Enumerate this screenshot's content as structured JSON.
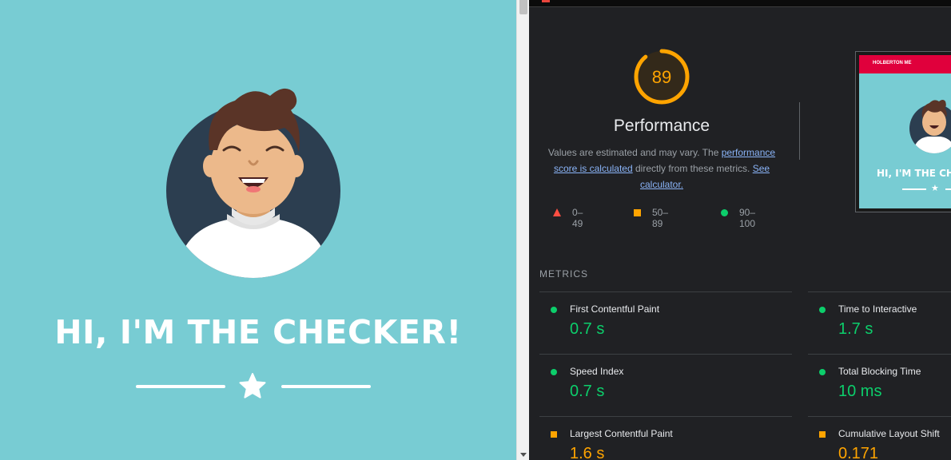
{
  "page": {
    "hero_title": "HI, I'M THE CHECKER!"
  },
  "lighthouse": {
    "score": "89",
    "score_color": "#ffa400",
    "category_title": "Performance",
    "description_prefix": "Values are estimated and may vary. The ",
    "description_link_1": "performance score is calculated",
    "description_middle": " directly from these metrics. ",
    "description_link_2": "See calculator.",
    "legend": [
      {
        "icon": "triangle",
        "range": "0–49",
        "color": "#ff4e42"
      },
      {
        "icon": "square",
        "range": "50–89",
        "color": "#ffa400"
      },
      {
        "icon": "circle",
        "range": "90–100",
        "color": "#0cce6b"
      }
    ],
    "thumbnail": {
      "nav_text": "HOLBERTON ME",
      "title": "HI, I'M THE CHECKER!"
    },
    "metrics_header": "METRICS",
    "metrics": [
      {
        "name": "First Contentful Paint",
        "value": "0.7 s",
        "status": "pass"
      },
      {
        "name": "Time to Interactive",
        "value": "1.7 s",
        "status": "pass"
      },
      {
        "name": "Speed Index",
        "value": "0.7 s",
        "status": "pass"
      },
      {
        "name": "Total Blocking Time",
        "value": "10 ms",
        "status": "pass"
      },
      {
        "name": "Largest Contentful Paint",
        "value": "1.6 s",
        "status": "average"
      },
      {
        "name": "Cumulative Layout Shift",
        "value": "0.171",
        "status": "average"
      }
    ]
  },
  "colors": {
    "page_background": "#78ccd3",
    "avatar_background": "#2c3e50",
    "panel_background": "#202124",
    "pass": "#0cce6b",
    "average": "#ffa400",
    "fail": "#ff4e42"
  }
}
